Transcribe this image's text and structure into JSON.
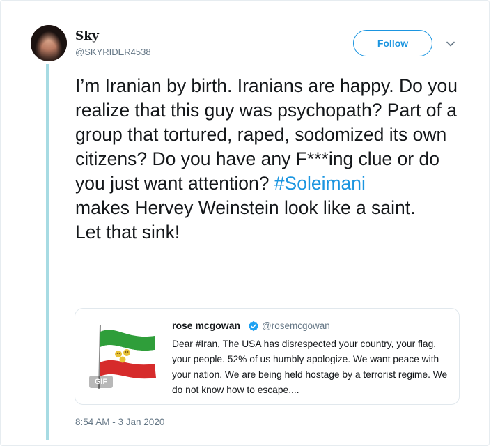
{
  "author": {
    "display_name": "Sky",
    "username": "@SKYRIDER4538"
  },
  "follow_button": {
    "label": "Follow",
    "color": "#1b95e0"
  },
  "tweet": {
    "text_before": "I’m Iranian by birth. Iranians are happy. Do you realize that this guy was psychopath? Part of a group that tortured, raped, sodomized its own citizens? Do you have any F***ing clue or do you just want attention? ",
    "hashtag": "#Soleimani",
    "text_after": "\n makes Hervey Weinstein look like a saint.\nLet that sink!",
    "timestamp": "8:54 AM - 3 Jan 2020"
  },
  "quoted_tweet": {
    "display_name": "rose mcgowan",
    "username": "@rosemcgowan",
    "verified": true,
    "text": "Dear #Iran, The USA has disrespected your country, your flag, your people. 52% of us humbly apologize. We want peace with your nation. We are being held hostage by a terrorist regime. We do not know how to escape....",
    "media_badge": "GIF",
    "media_icon": "iran-flag-image"
  },
  "colors": {
    "accent": "#1b95e0",
    "secondary_text": "#657786",
    "thread_line": "#a7dbe3",
    "border": "#e1e8ed"
  }
}
